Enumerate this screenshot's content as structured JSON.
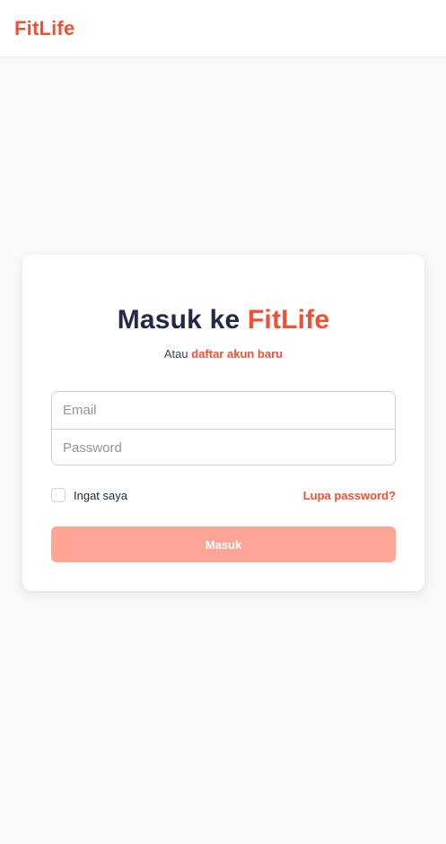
{
  "header": {
    "brand": "FitLife"
  },
  "login": {
    "title_prefix": "Masuk ke ",
    "title_brand": "FitLife",
    "subtitle_prefix": "Atau ",
    "subtitle_link": "daftar akun baru",
    "email_placeholder": "Email",
    "email_value": "",
    "password_placeholder": "Password",
    "password_value": "",
    "remember_label": "Ingat saya",
    "remember_checked": false,
    "forgot_link": "Lupa password?",
    "submit_label": "Masuk"
  },
  "colors": {
    "brand": "#f05033",
    "button_disabled": "#ffa595",
    "heading": "#222b45",
    "background": "#f8f9fb"
  }
}
